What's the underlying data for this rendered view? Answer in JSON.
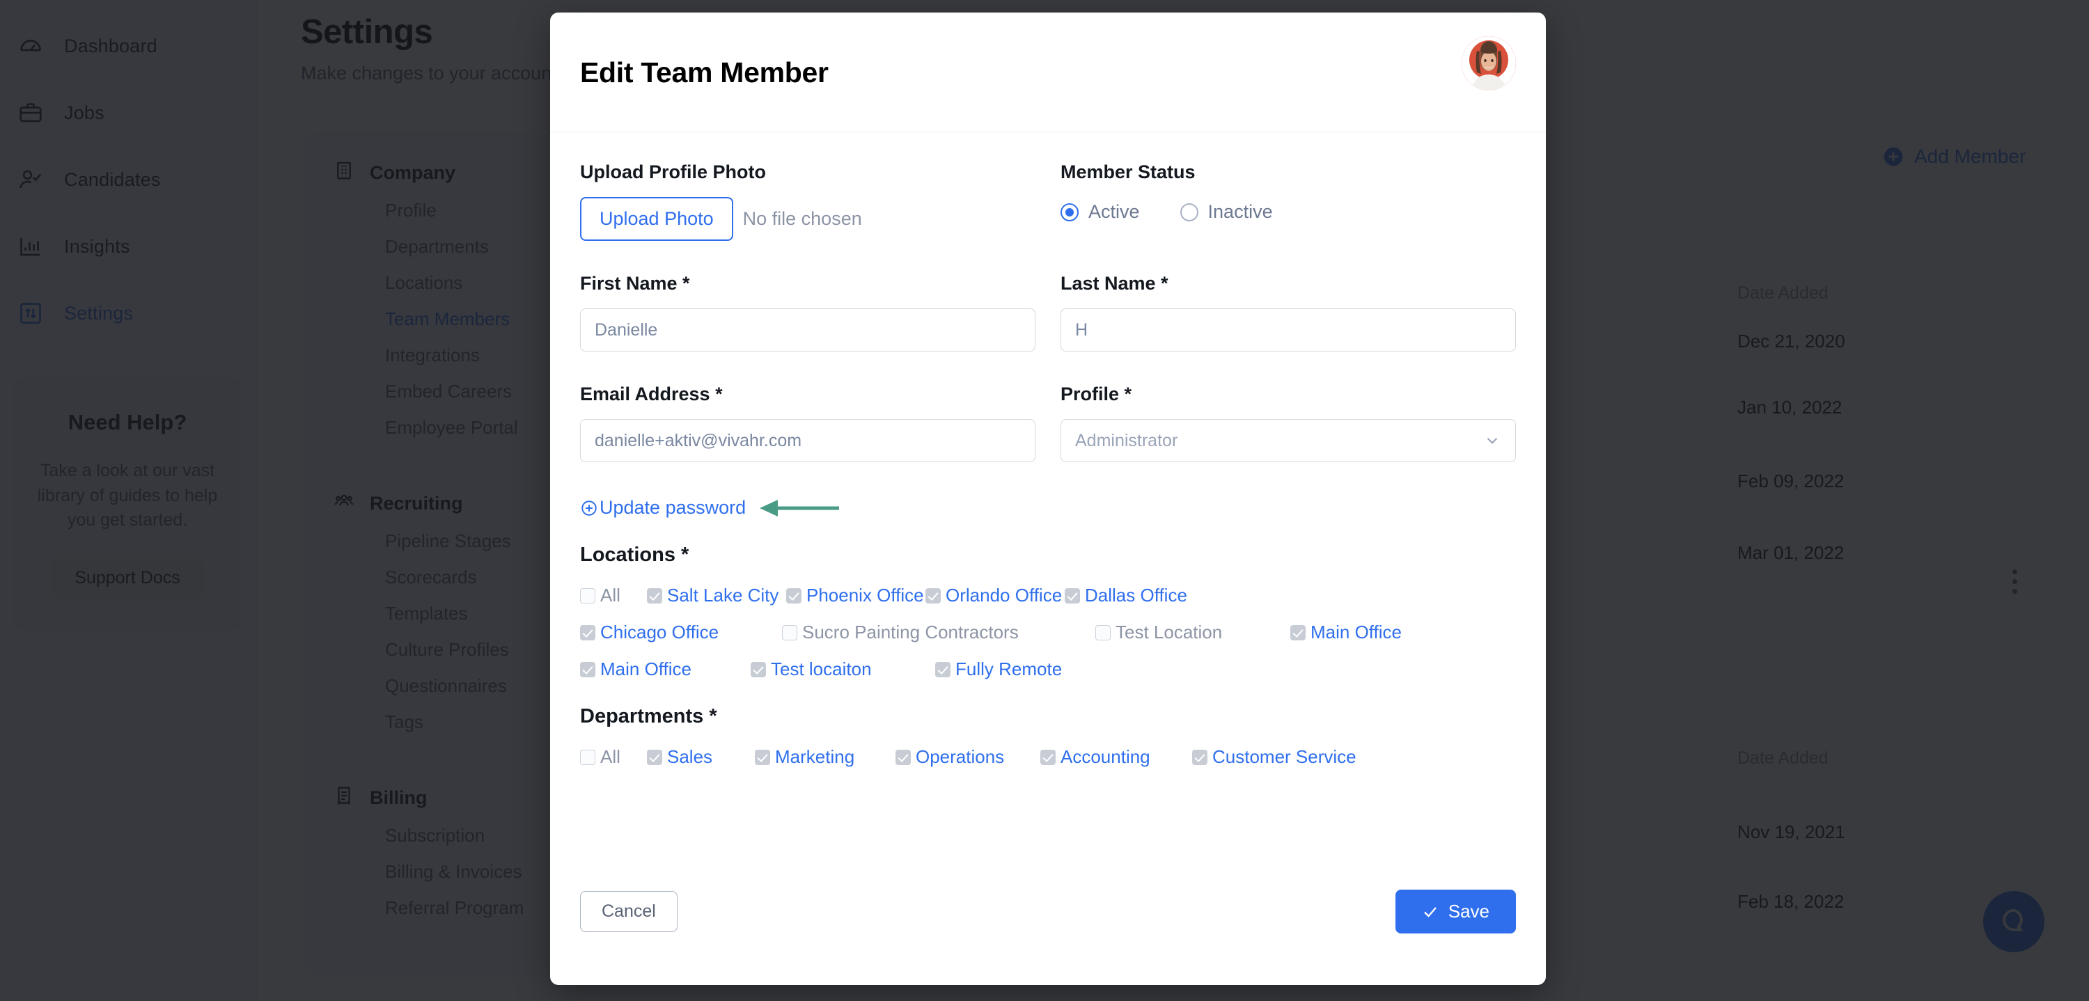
{
  "app": {
    "sidebar": {
      "items": [
        {
          "label": "Dashboard",
          "icon": "gauge-icon",
          "active": false
        },
        {
          "label": "Jobs",
          "icon": "briefcase-icon",
          "active": false
        },
        {
          "label": "Candidates",
          "icon": "user-check-icon",
          "active": false
        },
        {
          "label": "Insights",
          "icon": "bar-chart-icon",
          "active": false
        },
        {
          "label": "Settings",
          "icon": "sliders-icon",
          "active": true
        }
      ],
      "help_card": {
        "title": "Need Help?",
        "body": "Take a look at our vast library of guides to help you get started.",
        "button": "Support Docs"
      }
    },
    "page": {
      "title": "Settings",
      "subtitle": "Make changes to your account",
      "add_member_label": "Add Member"
    },
    "settings_menu": [
      {
        "section": "Company",
        "icon": "building-icon",
        "links": [
          {
            "label": "Profile",
            "active": false
          },
          {
            "label": "Departments",
            "active": false
          },
          {
            "label": "Locations",
            "active": false
          },
          {
            "label": "Team Members",
            "active": true
          },
          {
            "label": "Integrations",
            "active": false
          },
          {
            "label": "Embed Careers",
            "active": false
          },
          {
            "label": "Employee Portal",
            "active": false
          }
        ]
      },
      {
        "section": "Recruiting",
        "icon": "people-icon",
        "links": [
          {
            "label": "Pipeline Stages",
            "active": false
          },
          {
            "label": "Scorecards",
            "active": false
          },
          {
            "label": "Templates",
            "active": false
          },
          {
            "label": "Culture Profiles",
            "active": false
          },
          {
            "label": "Questionnaires",
            "active": false
          },
          {
            "label": "Tags",
            "active": false
          }
        ]
      },
      {
        "section": "Billing",
        "icon": "receipt-icon",
        "links": [
          {
            "label": "Subscription",
            "active": false
          },
          {
            "label": "Billing & Invoices",
            "active": false
          },
          {
            "label": "Referral Program",
            "active": false
          }
        ]
      }
    ],
    "table": {
      "date_column_header": "Date Added",
      "dates_top": [
        "Dec 21, 2020",
        "Jan 10, 2022",
        "Feb 09, 2022",
        "Mar 01, 2022"
      ],
      "date_column_header_2": "Date Added",
      "dates_bottom": [
        "Nov 19, 2021",
        "Feb 18, 2022"
      ]
    }
  },
  "modal": {
    "title": "Edit Team Member",
    "avatar_icon": "user-avatar-photo",
    "upload": {
      "label": "Upload Profile Photo",
      "button": "Upload Photo",
      "file_status": "No file chosen"
    },
    "status": {
      "label": "Member Status",
      "options": [
        {
          "label": "Active",
          "selected": true
        },
        {
          "label": "Inactive",
          "selected": false
        }
      ]
    },
    "fields": {
      "first_name": {
        "label": "First Name *",
        "value": "Danielle"
      },
      "last_name": {
        "label": "Last Name *",
        "value": "H"
      },
      "email": {
        "label": "Email Address *",
        "value": "danielle+aktiv@vivahr.com"
      },
      "profile": {
        "label": "Profile *",
        "value": "Administrator",
        "chevron": "chevron-down-icon"
      }
    },
    "update_password": {
      "label": "Update password",
      "icon": "plus-circle-icon",
      "annotation_arrow": "left-arrow-annotation",
      "annotation_color": "#4a9b86"
    },
    "locations": {
      "label": "Locations *",
      "rows": [
        [
          {
            "label": "All",
            "checked": false
          },
          {
            "label": "Salt Lake City",
            "checked": true
          },
          {
            "label": "Phoenix Office",
            "checked": true
          },
          {
            "label": "Orlando Office",
            "checked": true
          },
          {
            "label": "Dallas Office",
            "checked": true
          }
        ],
        [
          {
            "label": "Chicago Office",
            "checked": true
          },
          {
            "label": "Sucro Painting Contractors",
            "checked": false
          },
          {
            "label": "Test Location",
            "checked": false
          },
          {
            "label": "Main Office",
            "checked": true
          }
        ],
        [
          {
            "label": "Main Office",
            "checked": true
          },
          {
            "label": "Test locaiton",
            "checked": true
          },
          {
            "label": "Fully Remote",
            "checked": true
          }
        ]
      ]
    },
    "departments": {
      "label": "Departments *",
      "rows": [
        [
          {
            "label": "All",
            "checked": false
          },
          {
            "label": "Sales",
            "checked": true
          },
          {
            "label": "Marketing",
            "checked": true
          },
          {
            "label": "Operations",
            "checked": true
          },
          {
            "label": "Accounting",
            "checked": true
          },
          {
            "label": "Customer Service",
            "checked": true
          }
        ]
      ]
    },
    "footer": {
      "cancel": "Cancel",
      "save": "Save",
      "save_icon": "check-icon"
    }
  },
  "colors": {
    "accent_blue": "#2f6fed",
    "annotation_green": "#4a9b86",
    "avatar_bg": "#d9503b",
    "overlay": "rgba(24,26,30,0.86)",
    "muted_text": "#8c94a5"
  }
}
